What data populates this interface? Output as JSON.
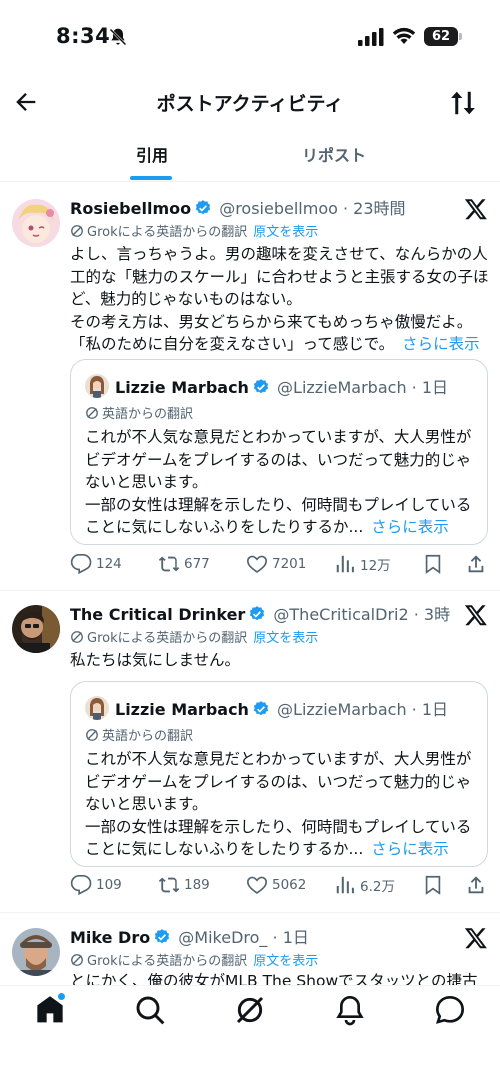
{
  "status_bar": {
    "time": "8:34",
    "battery": "62"
  },
  "header": {
    "title": "ポストアクティビティ"
  },
  "tabs": [
    {
      "label": "引用",
      "active": true
    },
    {
      "label": "リポスト",
      "active": false
    }
  ],
  "translate_label": "Grokによる英語からの翻訳",
  "show_original": "原文を表示",
  "quote_translate_label": "英語からの翻訳",
  "show_more": "さらに表示",
  "quoted_post": {
    "name": "Lizzie Marbach",
    "handle": "@LizzieMarbach",
    "time": "· 1日",
    "lines": [
      "これが不人気な意見だとわかっていますが、大人男性が",
      "ビデオゲームをプレイするのは、いつだって魅力的じゃ",
      "ないと思います。",
      "一部の女性は理解を示したり、何時間もプレイしている",
      "ことに気にしないふりをしたりするか..."
    ]
  },
  "posts": [
    {
      "name": "Rosiebellmoo",
      "handle": "@rosiebellmoo",
      "time": "· 23時間",
      "lines": [
        "よし、言っちゃうよ。男の趣味を変えさせて、なんらかの人",
        "工的な「魅力のスケール」に合わせようと主張する女の子ほ",
        "ど、魅力的じゃないものはない。",
        "その考え方は、男女どちらから来てもめっちゃ傲慢だよ。",
        "「私のために自分を変えなさい」って感じで。"
      ],
      "stats": {
        "replies": "124",
        "reposts": "677",
        "likes": "7201",
        "views": "12万"
      }
    },
    {
      "name": "The Critical Drinker",
      "handle": "@TheCriticalDri2",
      "time": "· 3時間",
      "lines": [
        "私たちは気にしません。"
      ],
      "stats": {
        "replies": "109",
        "reposts": "189",
        "likes": "5062",
        "views": "6.2万"
      }
    },
    {
      "name": "Mike Dro",
      "handle": "@MikeDro_",
      "time": "· 1日",
      "lines": [
        "とにかく、俺の彼女がMLB The Showでスタッツとの捷古"
      ]
    }
  ],
  "colors": {
    "accent": "#1d9bf0",
    "text": "#0f1419",
    "muted": "#536471",
    "border": "#cfd9de"
  },
  "bottom_nav": [
    "home-icon",
    "search-icon",
    "grok-icon",
    "notifications-icon",
    "messages-icon"
  ]
}
